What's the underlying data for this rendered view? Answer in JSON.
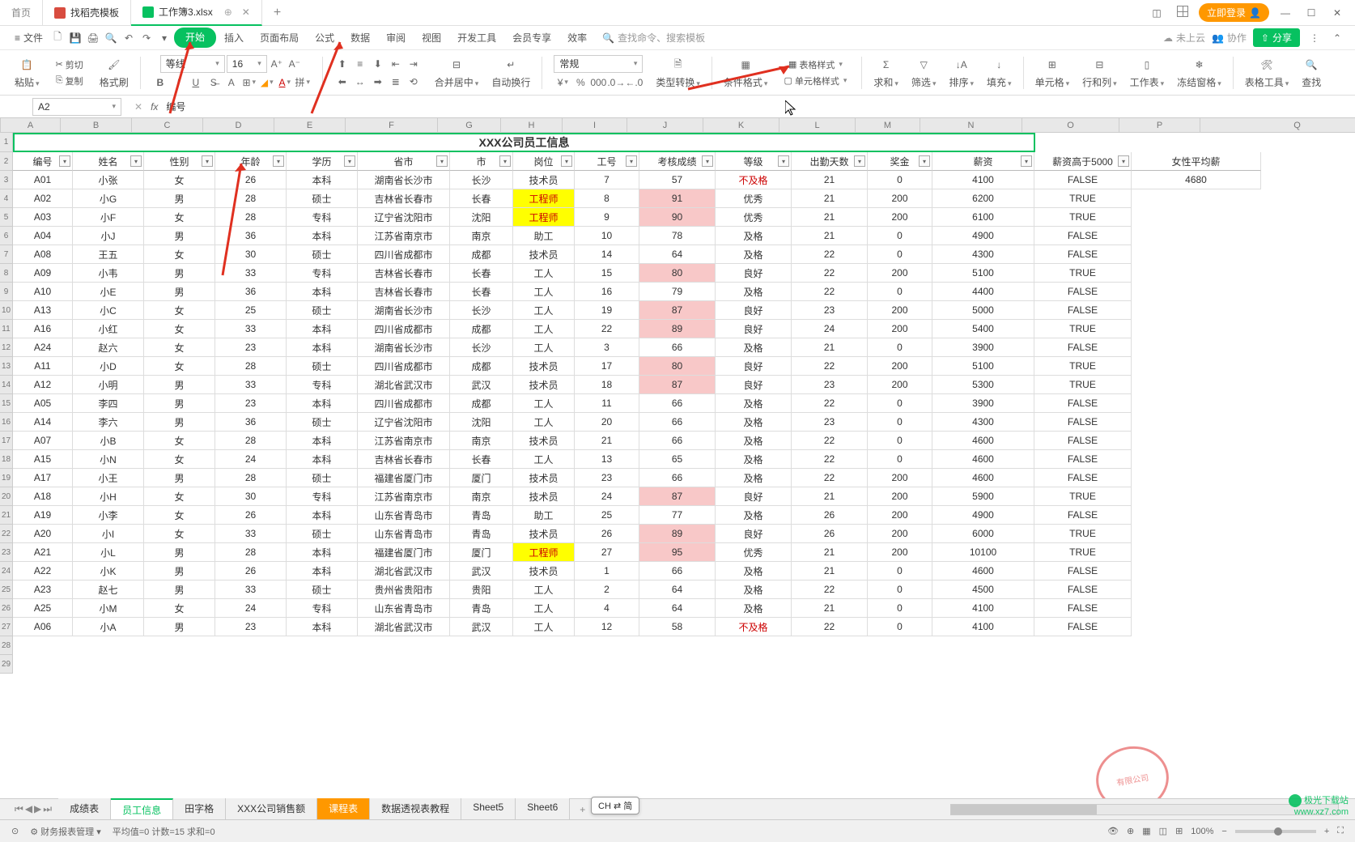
{
  "titlebar": {
    "home": "首页",
    "tab1": "找稻壳模板",
    "tab2": "工作簿3.xlsx",
    "login": "立即登录"
  },
  "menubar": {
    "file": "文件",
    "items": [
      "开始",
      "插入",
      "页面布局",
      "公式",
      "数据",
      "审阅",
      "视图",
      "开发工具",
      "会员专享",
      "效率"
    ],
    "search_placeholder": "查找命令、搜索模板",
    "cloud": "未上云",
    "coop": "协作",
    "share": "分享"
  },
  "ribbon": {
    "paste": "粘贴",
    "cut": "剪切",
    "copy": "复制",
    "format_painter": "格式刷",
    "font_name": "等线",
    "font_size": "16",
    "merge": "合并居中",
    "wrap": "自动换行",
    "number_format": "常规",
    "type_convert": "类型转换",
    "cond_format": "条件格式",
    "table_style": "表格样式",
    "cell_style": "单元格样式",
    "sum": "求和",
    "filter": "筛选",
    "sort": "排序",
    "fill": "填充",
    "cell": "单元格",
    "rowcol": "行和列",
    "sheet": "工作表",
    "freeze": "冻结窗格",
    "tools": "表格工具",
    "find": "查找"
  },
  "formula": {
    "cell_ref": "A2",
    "content": "编号"
  },
  "sheet": {
    "title": "XXX公司员工信息",
    "headers": [
      "编号",
      "姓名",
      "性别",
      "年龄",
      "学历",
      "省市",
      "市",
      "岗位",
      "工号",
      "考核成绩",
      "等级",
      "出勤天数",
      "奖金",
      "薪资",
      "薪资高于5000"
    ],
    "extra_header": "女性平均薪",
    "extra_value": "4680",
    "col_letters": [
      "A",
      "B",
      "C",
      "D",
      "E",
      "F",
      "G",
      "H",
      "I",
      "J",
      "K",
      "L",
      "M",
      "N",
      "O",
      "P"
    ],
    "rows": [
      {
        "n": 3,
        "d": [
          "A01",
          "小张",
          "女",
          "26",
          "本科",
          "湖南省长沙市",
          "长沙",
          "技术员",
          "7",
          "57",
          "不及格",
          "21",
          "0",
          "4100",
          "FALSE"
        ],
        "pink": [],
        "yellow": [],
        "red": [
          10
        ]
      },
      {
        "n": 4,
        "d": [
          "A02",
          "小G",
          "男",
          "28",
          "硕士",
          "吉林省长春市",
          "长春",
          "工程师",
          "8",
          "91",
          "优秀",
          "21",
          "200",
          "6200",
          "TRUE"
        ],
        "pink": [
          9
        ],
        "yellow": [
          7
        ],
        "red": []
      },
      {
        "n": 5,
        "d": [
          "A03",
          "小F",
          "女",
          "28",
          "专科",
          "辽宁省沈阳市",
          "沈阳",
          "工程师",
          "9",
          "90",
          "优秀",
          "21",
          "200",
          "6100",
          "TRUE"
        ],
        "pink": [
          9
        ],
        "yellow": [
          7
        ],
        "red": []
      },
      {
        "n": 6,
        "d": [
          "A04",
          "小J",
          "男",
          "36",
          "本科",
          "江苏省南京市",
          "南京",
          "助工",
          "10",
          "78",
          "及格",
          "21",
          "0",
          "4900",
          "FALSE"
        ],
        "pink": [],
        "yellow": [],
        "red": []
      },
      {
        "n": 7,
        "d": [
          "A08",
          "王五",
          "女",
          "30",
          "硕士",
          "四川省成都市",
          "成都",
          "技术员",
          "14",
          "64",
          "及格",
          "22",
          "0",
          "4300",
          "FALSE"
        ],
        "pink": [],
        "yellow": [],
        "red": []
      },
      {
        "n": 8,
        "d": [
          "A09",
          "小韦",
          "男",
          "33",
          "专科",
          "吉林省长春市",
          "长春",
          "工人",
          "15",
          "80",
          "良好",
          "22",
          "200",
          "5100",
          "TRUE"
        ],
        "pink": [
          9
        ],
        "yellow": [],
        "red": []
      },
      {
        "n": 9,
        "d": [
          "A10",
          "小E",
          "男",
          "36",
          "本科",
          "吉林省长春市",
          "长春",
          "工人",
          "16",
          "79",
          "及格",
          "22",
          "0",
          "4400",
          "FALSE"
        ],
        "pink": [],
        "yellow": [],
        "red": []
      },
      {
        "n": 10,
        "d": [
          "A13",
          "小C",
          "女",
          "25",
          "硕士",
          "湖南省长沙市",
          "长沙",
          "工人",
          "19",
          "87",
          "良好",
          "23",
          "200",
          "5000",
          "FALSE"
        ],
        "pink": [
          9
        ],
        "yellow": [],
        "red": []
      },
      {
        "n": 11,
        "d": [
          "A16",
          "小红",
          "女",
          "33",
          "本科",
          "四川省成都市",
          "成都",
          "工人",
          "22",
          "89",
          "良好",
          "24",
          "200",
          "5400",
          "TRUE"
        ],
        "pink": [
          9
        ],
        "yellow": [],
        "red": []
      },
      {
        "n": 12,
        "d": [
          "A24",
          "赵六",
          "女",
          "23",
          "本科",
          "湖南省长沙市",
          "长沙",
          "工人",
          "3",
          "66",
          "及格",
          "21",
          "0",
          "3900",
          "FALSE"
        ],
        "pink": [],
        "yellow": [],
        "red": []
      },
      {
        "n": 13,
        "d": [
          "A11",
          "小D",
          "女",
          "28",
          "硕士",
          "四川省成都市",
          "成都",
          "技术员",
          "17",
          "80",
          "良好",
          "22",
          "200",
          "5100",
          "TRUE"
        ],
        "pink": [
          9
        ],
        "yellow": [],
        "red": []
      },
      {
        "n": 14,
        "d": [
          "A12",
          "小明",
          "男",
          "33",
          "专科",
          "湖北省武汉市",
          "武汉",
          "技术员",
          "18",
          "87",
          "良好",
          "23",
          "200",
          "5300",
          "TRUE"
        ],
        "pink": [
          9
        ],
        "yellow": [],
        "red": []
      },
      {
        "n": 15,
        "d": [
          "A05",
          "李四",
          "男",
          "23",
          "本科",
          "四川省成都市",
          "成都",
          "工人",
          "11",
          "66",
          "及格",
          "22",
          "0",
          "3900",
          "FALSE"
        ],
        "pink": [],
        "yellow": [],
        "red": []
      },
      {
        "n": 16,
        "d": [
          "A14",
          "李六",
          "男",
          "36",
          "硕士",
          "辽宁省沈阳市",
          "沈阳",
          "工人",
          "20",
          "66",
          "及格",
          "23",
          "0",
          "4300",
          "FALSE"
        ],
        "pink": [],
        "yellow": [],
        "red": []
      },
      {
        "n": 17,
        "d": [
          "A07",
          "小B",
          "女",
          "28",
          "本科",
          "江苏省南京市",
          "南京",
          "技术员",
          "21",
          "66",
          "及格",
          "22",
          "0",
          "4600",
          "FALSE"
        ],
        "pink": [],
        "yellow": [],
        "red": []
      },
      {
        "n": 18,
        "d": [
          "A15",
          "小N",
          "女",
          "24",
          "本科",
          "吉林省长春市",
          "长春",
          "工人",
          "13",
          "65",
          "及格",
          "22",
          "0",
          "4600",
          "FALSE"
        ],
        "pink": [],
        "yellow": [],
        "red": []
      },
      {
        "n": 19,
        "d": [
          "A17",
          "小王",
          "男",
          "28",
          "硕士",
          "福建省厦门市",
          "厦门",
          "技术员",
          "23",
          "66",
          "及格",
          "22",
          "200",
          "4600",
          "FALSE"
        ],
        "pink": [],
        "yellow": [],
        "red": []
      },
      {
        "n": 20,
        "d": [
          "A18",
          "小H",
          "女",
          "30",
          "专科",
          "江苏省南京市",
          "南京",
          "技术员",
          "24",
          "87",
          "良好",
          "21",
          "200",
          "5900",
          "TRUE"
        ],
        "pink": [
          9
        ],
        "yellow": [],
        "red": []
      },
      {
        "n": 21,
        "d": [
          "A19",
          "小李",
          "女",
          "26",
          "本科",
          "山东省青岛市",
          "青岛",
          "助工",
          "25",
          "77",
          "及格",
          "26",
          "200",
          "4900",
          "FALSE"
        ],
        "pink": [],
        "yellow": [],
        "red": []
      },
      {
        "n": 22,
        "d": [
          "A20",
          "小I",
          "女",
          "33",
          "硕士",
          "山东省青岛市",
          "青岛",
          "技术员",
          "26",
          "89",
          "良好",
          "26",
          "200",
          "6000",
          "TRUE"
        ],
        "pink": [
          9
        ],
        "yellow": [],
        "red": []
      },
      {
        "n": 23,
        "d": [
          "A21",
          "小L",
          "男",
          "28",
          "本科",
          "福建省厦门市",
          "厦门",
          "工程师",
          "27",
          "95",
          "优秀",
          "21",
          "200",
          "10100",
          "TRUE"
        ],
        "pink": [
          9
        ],
        "yellow": [
          7
        ],
        "red": []
      },
      {
        "n": 24,
        "d": [
          "A22",
          "小K",
          "男",
          "26",
          "本科",
          "湖北省武汉市",
          "武汉",
          "技术员",
          "1",
          "66",
          "及格",
          "21",
          "0",
          "4600",
          "FALSE"
        ],
        "pink": [],
        "yellow": [],
        "red": []
      },
      {
        "n": 25,
        "d": [
          "A23",
          "赵七",
          "男",
          "33",
          "硕士",
          "贵州省贵阳市",
          "贵阳",
          "工人",
          "2",
          "64",
          "及格",
          "22",
          "0",
          "4500",
          "FALSE"
        ],
        "pink": [],
        "yellow": [],
        "red": []
      },
      {
        "n": 26,
        "d": [
          "A25",
          "小M",
          "女",
          "24",
          "专科",
          "山东省青岛市",
          "青岛",
          "工人",
          "4",
          "64",
          "及格",
          "21",
          "0",
          "4100",
          "FALSE"
        ],
        "pink": [],
        "yellow": [],
        "red": []
      },
      {
        "n": 27,
        "d": [
          "A06",
          "小A",
          "男",
          "23",
          "本科",
          "湖北省武汉市",
          "武汉",
          "工人",
          "12",
          "58",
          "不及格",
          "22",
          "0",
          "4100",
          "FALSE"
        ],
        "pink": [],
        "yellow": [],
        "red": [
          10
        ]
      }
    ]
  },
  "sheet_tabs": [
    "成绩表",
    "员工信息",
    "田字格",
    "XXX公司销售额",
    "课程表",
    "数据透视表教程",
    "Sheet5",
    "Sheet6"
  ],
  "active_sheet_idx": 1,
  "orange_sheet_idx": 4,
  "status": {
    "mgmt": "财务报表管理",
    "stats": "平均值=0  计数=15  求和=0",
    "ime": "CH ⇄ 简",
    "zoom": "100%"
  },
  "watermark": {
    "l1": "极光下载站",
    "l2": "www.xz7.com"
  }
}
